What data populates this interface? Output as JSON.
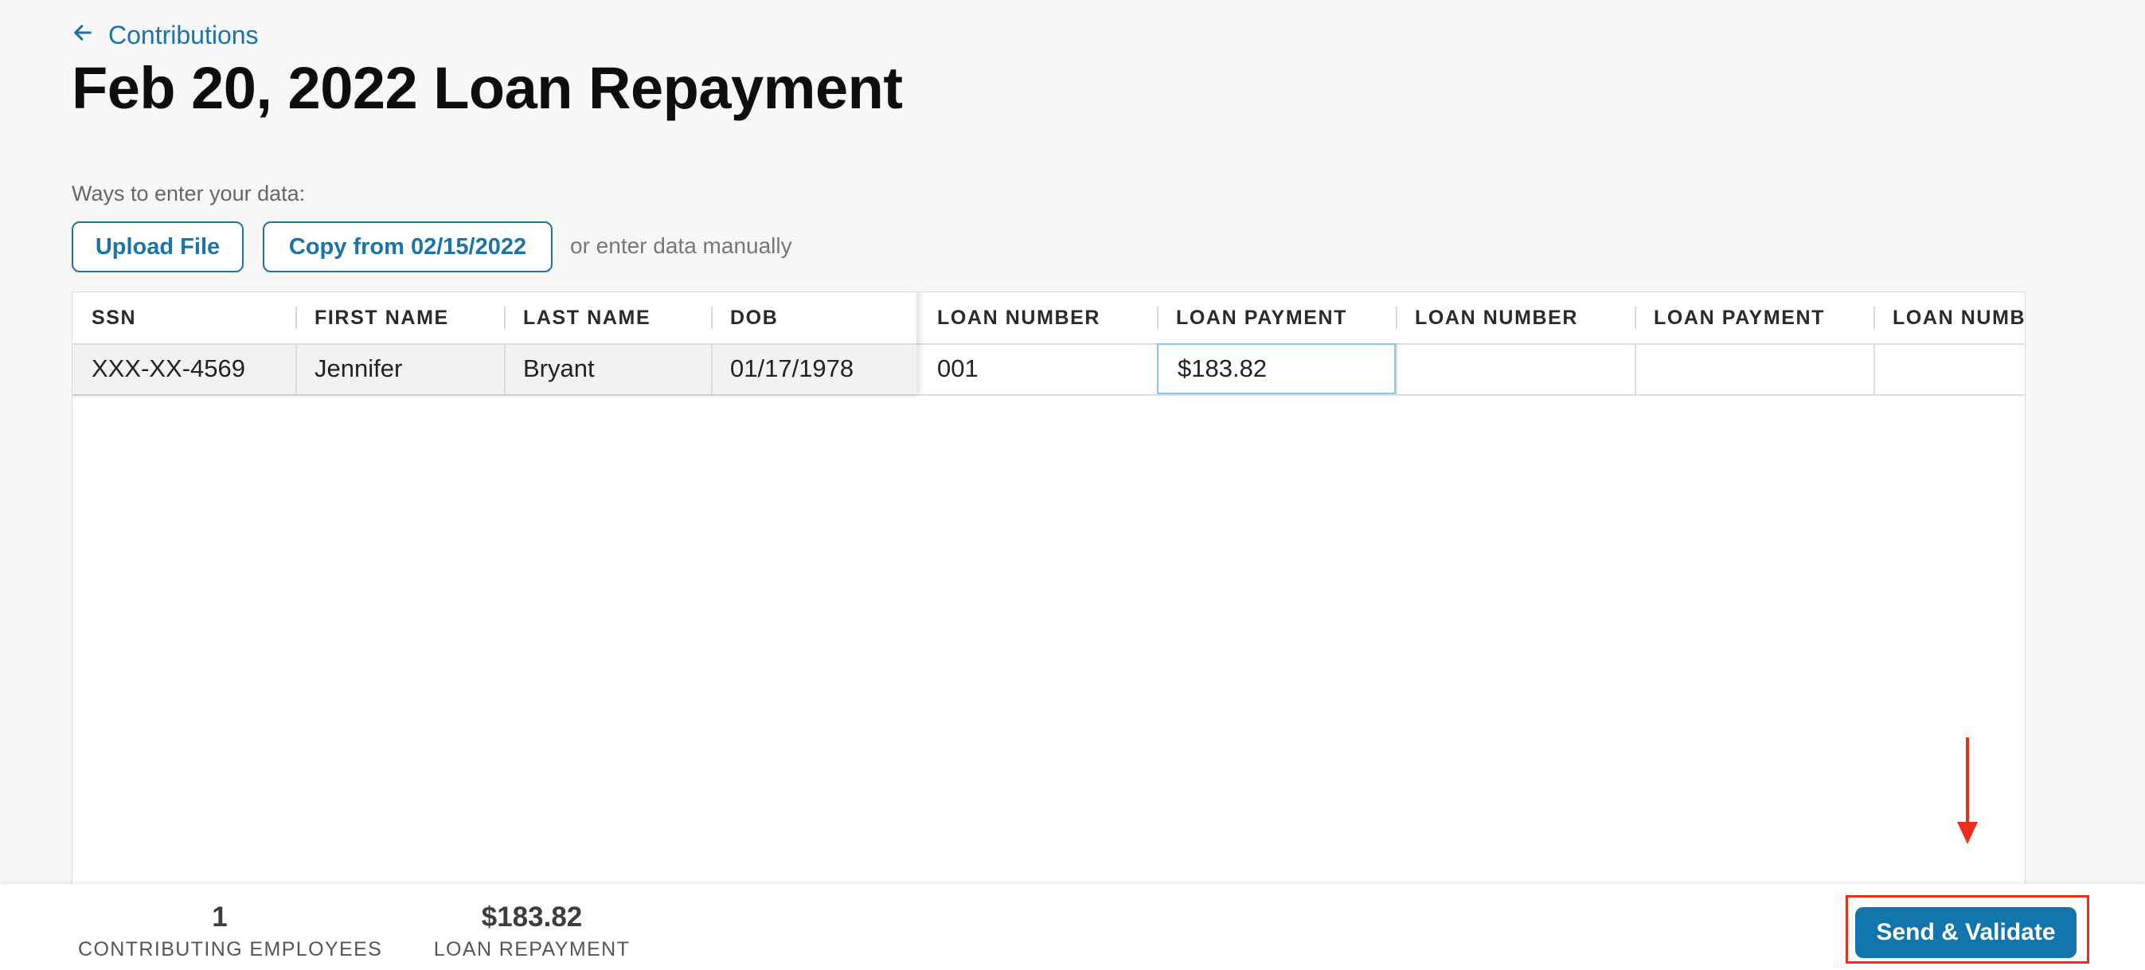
{
  "breadcrumb": {
    "label": "Contributions",
    "icon": "arrow-left-icon"
  },
  "page": {
    "title": "Feb 20, 2022 Loan Repayment"
  },
  "entry_options": {
    "label": "Ways to enter your data:",
    "upload_button": "Upload File",
    "copy_button": "Copy from 02/15/2022",
    "manual_text": "or enter data manually"
  },
  "table": {
    "columns": [
      "SSN",
      "FIRST NAME",
      "LAST NAME",
      "DOB",
      "LOAN NUMBER",
      "LOAN PAYMENT",
      "LOAN NUMBER",
      "LOAN PAYMENT",
      "LOAN NUMBER"
    ],
    "rows": [
      [
        "XXX-XX-4569",
        "Jennifer",
        "Bryant",
        "01/17/1978",
        "001",
        "$183.82",
        "",
        "",
        ""
      ]
    ]
  },
  "footer": {
    "contributing_employees": {
      "value": "1",
      "label": "CONTRIBUTING EMPLOYEES"
    },
    "loan_repayment": {
      "value": "$183.82",
      "label": "LOAN REPAYMENT"
    },
    "send_button": "Send & Validate"
  },
  "colors": {
    "accent": "#1b73a8",
    "primary_button": "#1275ab",
    "annotation": "#e8301c",
    "editing_cell_border": "#8ec5e6"
  }
}
